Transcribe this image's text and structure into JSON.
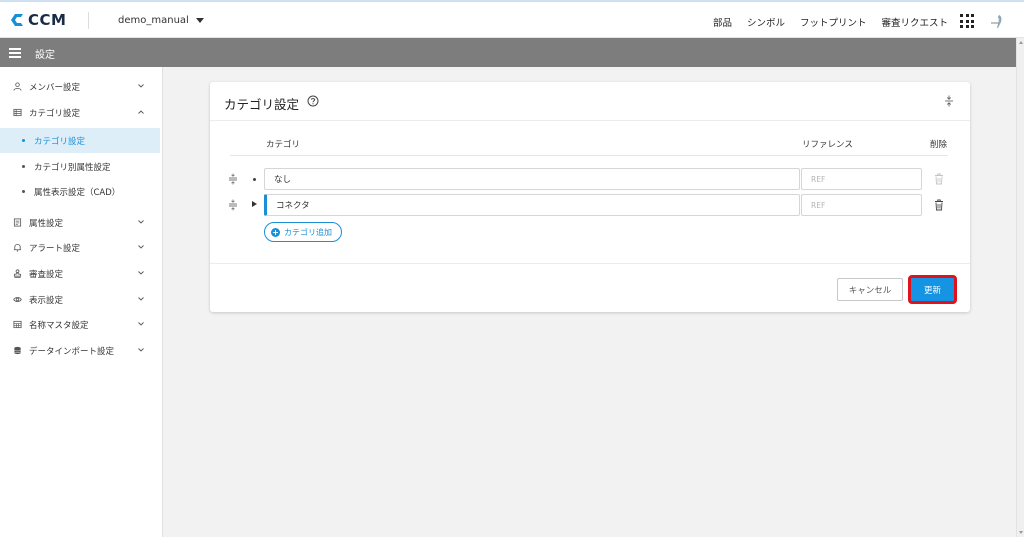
{
  "brand": {
    "name": "CCM",
    "accent": "#1a8fd6"
  },
  "project": {
    "name": "demo_manual"
  },
  "topnav": {
    "items": [
      "部品",
      "シンボル",
      "フットプリント",
      "審査リクエスト"
    ]
  },
  "section": {
    "title": "設定"
  },
  "sidebar": {
    "items": [
      {
        "label": "メンバー設定",
        "icon": "person-icon",
        "expanded": false
      },
      {
        "label": "カテゴリ設定",
        "icon": "list-icon",
        "expanded": true
      },
      {
        "label": "属性設定",
        "icon": "document-icon",
        "expanded": false
      },
      {
        "label": "アラート設定",
        "icon": "bell-icon",
        "expanded": false
      },
      {
        "label": "審査設定",
        "icon": "stamp-icon",
        "expanded": false
      },
      {
        "label": "表示設定",
        "icon": "eye-icon",
        "expanded": false
      },
      {
        "label": "名称マスタ設定",
        "icon": "calculator-icon",
        "expanded": false
      },
      {
        "label": "データインポート設定",
        "icon": "database-icon",
        "expanded": false
      }
    ],
    "subitems": [
      {
        "label": "カテゴリ設定",
        "active": true
      },
      {
        "label": "カテゴリ別属性設定",
        "active": false
      },
      {
        "label": "属性表示設定（CAD）",
        "active": false
      }
    ]
  },
  "card": {
    "title": "カテゴリ設定",
    "columns": {
      "category": "カテゴリ",
      "reference": "リファレンス",
      "delete": "削除"
    },
    "rows": [
      {
        "name": "なし",
        "ref_placeholder": "REF",
        "expandable": false,
        "selected": false
      },
      {
        "name": "コネクタ",
        "ref_placeholder": "REF",
        "expandable": true,
        "selected": true
      }
    ],
    "add_label": "カテゴリ追加",
    "cancel_label": "キャンセル",
    "update_label": "更新"
  }
}
